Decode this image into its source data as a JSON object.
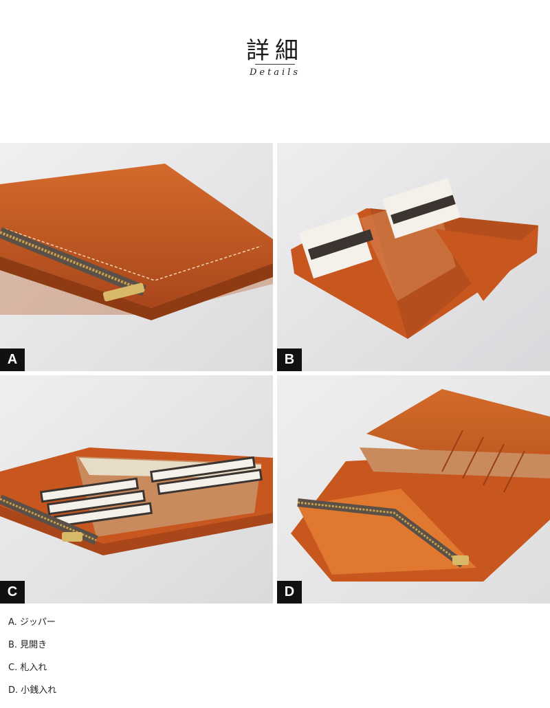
{
  "header": {
    "title": "詳細",
    "subtitle": "Details"
  },
  "photos": [
    {
      "label": "A"
    },
    {
      "label": "B"
    },
    {
      "label": "C"
    },
    {
      "label": "D"
    }
  ],
  "captions": [
    "A. ジッパー",
    "B. 見開き",
    "C. 札入れ",
    "D. 小銭入れ"
  ],
  "colors": {
    "leather": "#c8561f",
    "leather_dark": "#9a3f14",
    "zipper": "#c9a14a",
    "background": "#e9e9ea"
  }
}
